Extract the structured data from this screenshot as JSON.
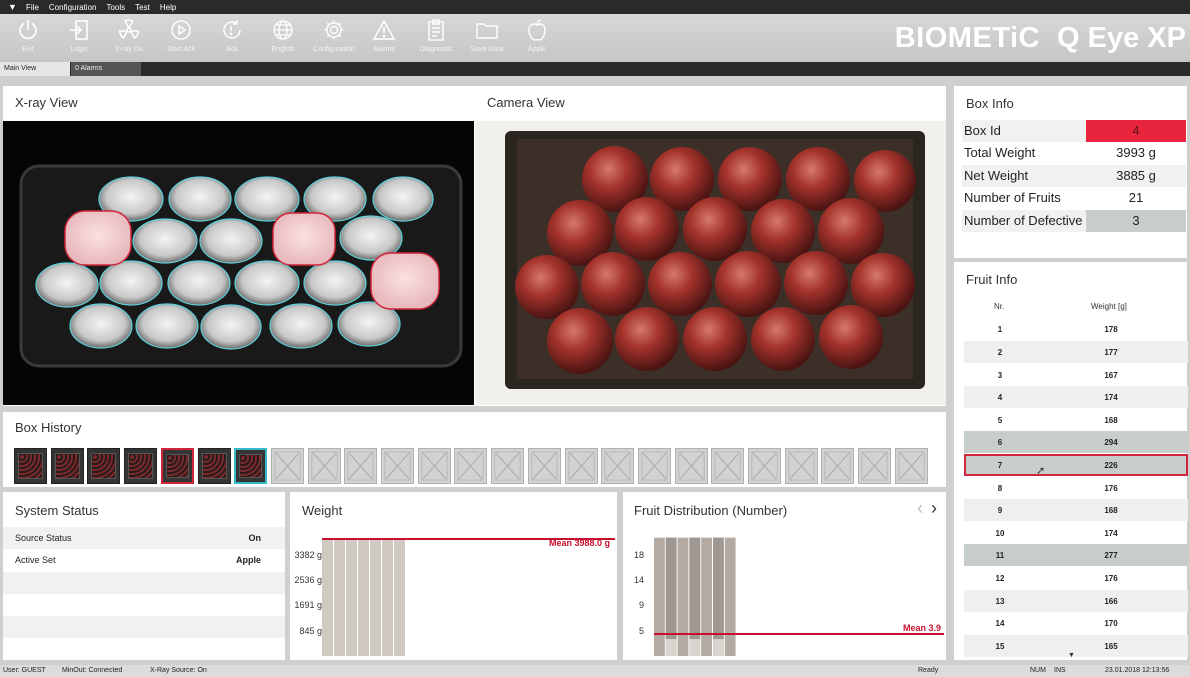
{
  "menu": [
    "File",
    "Configuration",
    "Tools",
    "Test",
    "Help"
  ],
  "toolbar": [
    {
      "label": "Exit",
      "icon": "power-icon"
    },
    {
      "label": "Login",
      "icon": "login-icon"
    },
    {
      "label": "X-ray On",
      "icon": "radiation-icon"
    },
    {
      "label": "Start Ack",
      "icon": "play-icon"
    },
    {
      "label": "Ack",
      "icon": "ack-icon"
    },
    {
      "label": "English",
      "icon": "globe-icon"
    },
    {
      "label": "Configuration",
      "icon": "gear-icon"
    },
    {
      "label": "Alarms",
      "icon": "warning-icon"
    },
    {
      "label": "Diagnostic",
      "icon": "clipboard-icon"
    },
    {
      "label": "Save Data",
      "icon": "folder-icon"
    },
    {
      "label": "Apple",
      "icon": "apple-icon"
    }
  ],
  "brand": {
    "pre": "BIOMET",
    "accent": "i",
    "post": "C",
    "product": "Q Eye XP"
  },
  "tabs": {
    "main": "Main View",
    "alarms": "0 Alarms"
  },
  "views": {
    "xray": "X-ray View",
    "camera": "Camera View"
  },
  "box_info": {
    "title": "Box Info",
    "rows": [
      {
        "label": "Box Id",
        "value": "4"
      },
      {
        "label": "Total Weight",
        "value": "3993 g"
      },
      {
        "label": "Net Weight",
        "value": "3885 g"
      },
      {
        "label": "Number of Fruits",
        "value": "21"
      },
      {
        "label": "Number of Defective",
        "value": "3"
      }
    ]
  },
  "fruit_info": {
    "title": "Fruit Info",
    "col_nr": "Nr.",
    "col_weight": "Weight [g]",
    "rows": [
      {
        "nr": "1",
        "weight": "178"
      },
      {
        "nr": "2",
        "weight": "177"
      },
      {
        "nr": "3",
        "weight": "167"
      },
      {
        "nr": "4",
        "weight": "174"
      },
      {
        "nr": "5",
        "weight": "168"
      },
      {
        "nr": "6",
        "weight": "294"
      },
      {
        "nr": "7",
        "weight": "226"
      },
      {
        "nr": "8",
        "weight": "176"
      },
      {
        "nr": "9",
        "weight": "168"
      },
      {
        "nr": "10",
        "weight": "174"
      },
      {
        "nr": "11",
        "weight": "277"
      },
      {
        "nr": "12",
        "weight": "176"
      },
      {
        "nr": "13",
        "weight": "166"
      },
      {
        "nr": "14",
        "weight": "170"
      },
      {
        "nr": "15",
        "weight": "165"
      }
    ]
  },
  "box_history": {
    "title": "Box History"
  },
  "system_status": {
    "title": "System Status",
    "rows": [
      {
        "label": "Source Status",
        "value": "On"
      },
      {
        "label": "Active Set",
        "value": "Apple"
      }
    ]
  },
  "weight_chart": {
    "title": "Weight",
    "ticks": [
      "3382 g",
      "2536 g",
      "1691 g",
      "845 g"
    ],
    "mean_label": "Mean 3988.0 g"
  },
  "dist_chart": {
    "title": "Fruit Distribution (Number)",
    "ticks": [
      "18",
      "14",
      "9",
      "5"
    ],
    "mean_label": "Mean 3.9"
  },
  "chart_data": [
    {
      "type": "bar",
      "title": "Weight",
      "values": [
        3993,
        3993,
        3993,
        3993,
        3993,
        3993,
        3993
      ],
      "ylim": [
        0,
        4228
      ],
      "mean": 3988.0
    },
    {
      "type": "bar",
      "title": "Fruit Distribution (Number)",
      "values": [
        21,
        21,
        21,
        21,
        21,
        21,
        21
      ],
      "defects": [
        0,
        3,
        0,
        3,
        0,
        3,
        0
      ],
      "ylim": [
        0,
        22
      ],
      "mean": 3.9
    }
  ],
  "statusbar": {
    "user": "User: GUEST",
    "minout": "MinOut: Connected",
    "xray": "X-Ray Source: On",
    "ready": "Ready",
    "num": "NUM",
    "ins": "INS",
    "datetime": "23.01.2018  12:13:56"
  },
  "colors": {
    "accent": "#c8102e",
    "cyan": "#37b9c7",
    "defect_row": "#c7cdca"
  }
}
